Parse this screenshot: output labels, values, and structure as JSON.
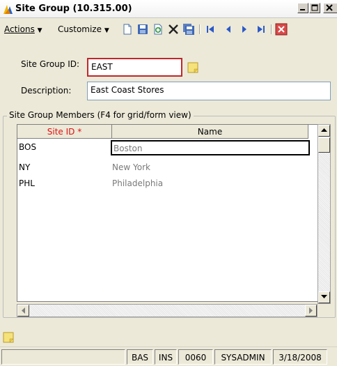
{
  "window": {
    "title": "Site Group (10.315.00)"
  },
  "menubar": {
    "actions_label": "Actions",
    "customize_label": "Customize",
    "tool_icons": [
      "new-icon",
      "save-icon",
      "refresh-icon",
      "delete-icon",
      "save-all-icon",
      "first-record-icon",
      "previous-record-icon",
      "next-record-icon",
      "last-record-icon",
      "close-form-icon"
    ]
  },
  "form": {
    "site_group_id_label": "Site Group ID:",
    "site_group_id_value": "EAST",
    "description_label": "Description:",
    "description_value": "East Coast Stores"
  },
  "members": {
    "group_title": "Site Group Members (F4 for grid/form view)",
    "columns": [
      "Site ID *",
      "Name"
    ],
    "rows": [
      {
        "site_id": "BOS",
        "name": "Boston"
      },
      {
        "site_id": "NY",
        "name": "New York"
      },
      {
        "site_id": "PHL",
        "name": "Philadelphia"
      }
    ]
  },
  "status": {
    "panels": [
      "BAS",
      "INS",
      "0060",
      "SYSADMIN",
      "3/18/2008"
    ]
  },
  "colors": {
    "required_header": "#e01010",
    "field_focus_border": "#c0262b",
    "name_text": "#7a7a7a"
  }
}
